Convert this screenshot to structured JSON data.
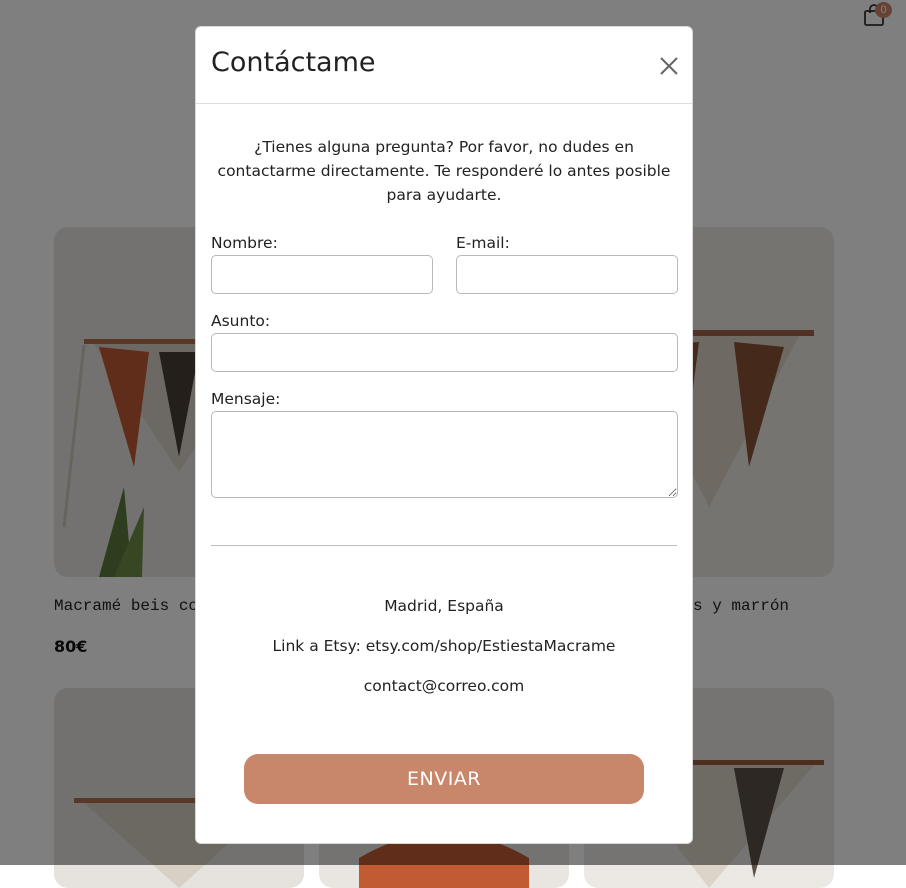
{
  "header": {
    "cart_icon": "shopping-bag-icon",
    "cart_count": "0"
  },
  "products": [
    {
      "title": "Macramé beis co",
      "price": "80€"
    },
    {
      "title": "s y marrón",
      "price": ""
    },
    {
      "title": "",
      "price": ""
    },
    {
      "title": "",
      "price": ""
    },
    {
      "title": "",
      "price": ""
    }
  ],
  "modal": {
    "title": "Contáctame",
    "close_icon": "close-icon",
    "intro": "¿Tienes alguna pregunta? Por favor, no dudes en contactarme directamente. Te responderé lo antes posible para ayudarte.",
    "fields": {
      "name": {
        "label": "Nombre:",
        "value": ""
      },
      "email": {
        "label": "E-mail:",
        "value": ""
      },
      "subject": {
        "label": "Asunto:",
        "value": ""
      },
      "message": {
        "label": "Mensaje:",
        "value": ""
      }
    },
    "info": {
      "location": "Madrid, España",
      "etsy": "Link a Etsy: etsy.com/shop/EstiestaMacrame",
      "email": "contact@correo.com"
    },
    "submit_label": "ENVIAR"
  },
  "colors": {
    "accent": "#c8876a",
    "overlay": "rgba(0,0,0,0.5)"
  }
}
